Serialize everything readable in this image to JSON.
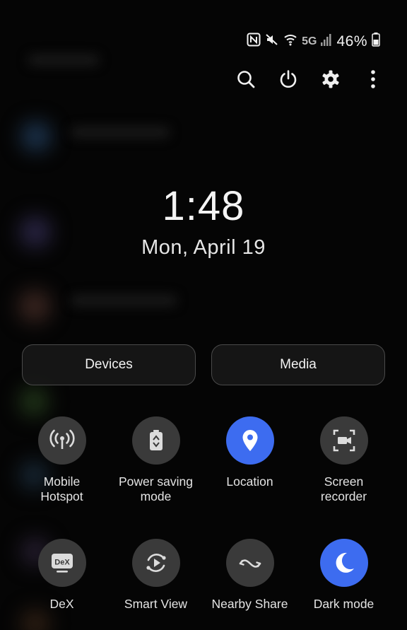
{
  "status": {
    "battery_percent": "46%",
    "network": "5G",
    "icons": [
      "nfc-icon",
      "mute-icon",
      "wifi-icon",
      "signal-icon",
      "battery-icon"
    ]
  },
  "actions": [
    "search-icon",
    "power-icon",
    "gear-icon",
    "more-vert-icon"
  ],
  "clock": {
    "time": "1:48",
    "date": "Mon, April 19"
  },
  "panel_buttons": {
    "devices": "Devices",
    "media": "Media"
  },
  "tiles": [
    {
      "label": "Mobile\nHotspot",
      "icon": "hotspot-icon",
      "active": false
    },
    {
      "label": "Power saving\nmode",
      "icon": "battery-saver-icon",
      "active": false
    },
    {
      "label": "Location",
      "icon": "location-pin-icon",
      "active": true
    },
    {
      "label": "Screen\nrecorder",
      "icon": "screen-recorder-icon",
      "active": false
    },
    {
      "label": "DeX",
      "icon": "dex-icon",
      "active": false
    },
    {
      "label": "Smart View",
      "icon": "smart-view-icon",
      "active": false
    },
    {
      "label": "Nearby Share",
      "icon": "nearby-share-icon",
      "active": false
    },
    {
      "label": "Dark mode",
      "icon": "moon-icon",
      "active": true
    }
  ],
  "tile_icon_text": {
    "dex": "DeX"
  },
  "colors": {
    "accent": "#3d6cf0",
    "tile_off": "#3a3a3a",
    "background": "#050505"
  }
}
